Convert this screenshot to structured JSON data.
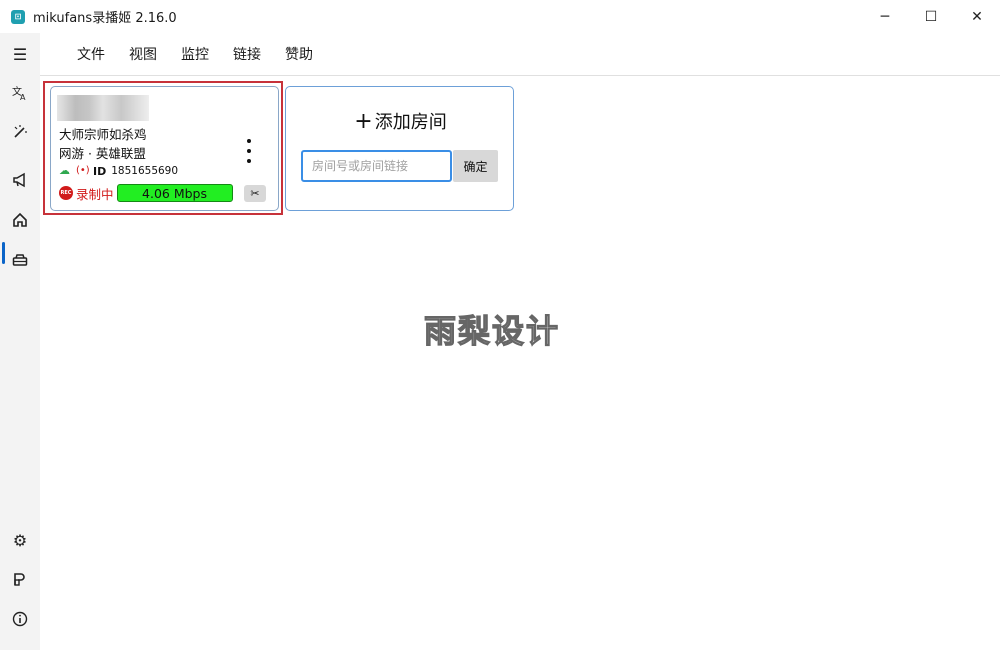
{
  "window": {
    "title": "mikufans录播姬 2.16.0",
    "minimize": "─",
    "maximize": "☐",
    "close": "✕"
  },
  "menu": [
    "文件",
    "视图",
    "监控",
    "链接",
    "赞助"
  ],
  "room_card": {
    "title": "大师宗师如杀鸡",
    "area": "网游 · 英雄联盟",
    "id_label": "ID",
    "room_id": "1851655690",
    "rec_badge": "REC",
    "rec_status": "录制中",
    "bitrate": "4.06 Mbps"
  },
  "add_room": {
    "plus": "+",
    "title": "添加房间",
    "placeholder": "房间号或房间链接",
    "confirm": "确定"
  },
  "watermark": "雨梨设计",
  "colors": {
    "accent": "#0a64c8",
    "recording": "#d11a1a",
    "bitrate_ok": "#22ee22",
    "highlight": "#c7323a"
  }
}
